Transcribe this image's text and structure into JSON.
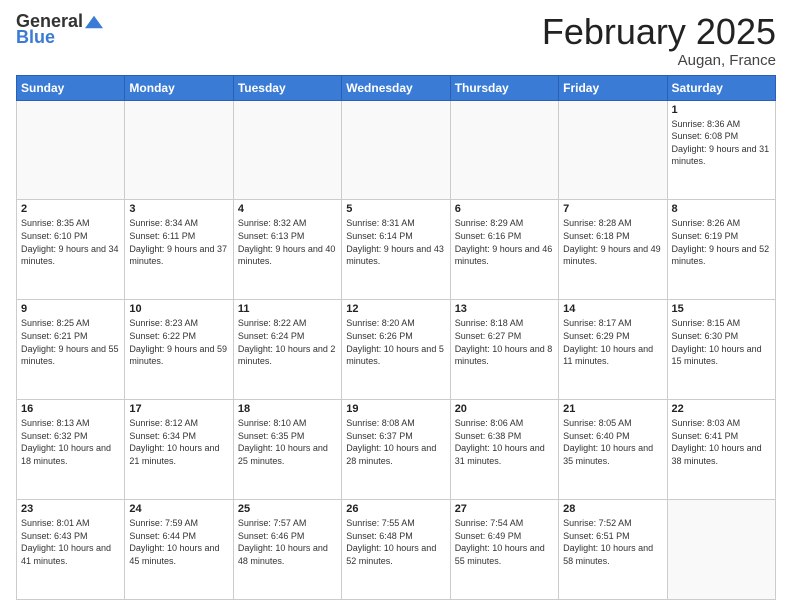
{
  "header": {
    "logo_general": "General",
    "logo_blue": "Blue",
    "month_year": "February 2025",
    "location": "Augan, France"
  },
  "days_of_week": [
    "Sunday",
    "Monday",
    "Tuesday",
    "Wednesday",
    "Thursday",
    "Friday",
    "Saturday"
  ],
  "weeks": [
    [
      {
        "day": "",
        "info": ""
      },
      {
        "day": "",
        "info": ""
      },
      {
        "day": "",
        "info": ""
      },
      {
        "day": "",
        "info": ""
      },
      {
        "day": "",
        "info": ""
      },
      {
        "day": "",
        "info": ""
      },
      {
        "day": "1",
        "info": "Sunrise: 8:36 AM\nSunset: 6:08 PM\nDaylight: 9 hours and 31 minutes."
      }
    ],
    [
      {
        "day": "2",
        "info": "Sunrise: 8:35 AM\nSunset: 6:10 PM\nDaylight: 9 hours and 34 minutes."
      },
      {
        "day": "3",
        "info": "Sunrise: 8:34 AM\nSunset: 6:11 PM\nDaylight: 9 hours and 37 minutes."
      },
      {
        "day": "4",
        "info": "Sunrise: 8:32 AM\nSunset: 6:13 PM\nDaylight: 9 hours and 40 minutes."
      },
      {
        "day": "5",
        "info": "Sunrise: 8:31 AM\nSunset: 6:14 PM\nDaylight: 9 hours and 43 minutes."
      },
      {
        "day": "6",
        "info": "Sunrise: 8:29 AM\nSunset: 6:16 PM\nDaylight: 9 hours and 46 minutes."
      },
      {
        "day": "7",
        "info": "Sunrise: 8:28 AM\nSunset: 6:18 PM\nDaylight: 9 hours and 49 minutes."
      },
      {
        "day": "8",
        "info": "Sunrise: 8:26 AM\nSunset: 6:19 PM\nDaylight: 9 hours and 52 minutes."
      }
    ],
    [
      {
        "day": "9",
        "info": "Sunrise: 8:25 AM\nSunset: 6:21 PM\nDaylight: 9 hours and 55 minutes."
      },
      {
        "day": "10",
        "info": "Sunrise: 8:23 AM\nSunset: 6:22 PM\nDaylight: 9 hours and 59 minutes."
      },
      {
        "day": "11",
        "info": "Sunrise: 8:22 AM\nSunset: 6:24 PM\nDaylight: 10 hours and 2 minutes."
      },
      {
        "day": "12",
        "info": "Sunrise: 8:20 AM\nSunset: 6:26 PM\nDaylight: 10 hours and 5 minutes."
      },
      {
        "day": "13",
        "info": "Sunrise: 8:18 AM\nSunset: 6:27 PM\nDaylight: 10 hours and 8 minutes."
      },
      {
        "day": "14",
        "info": "Sunrise: 8:17 AM\nSunset: 6:29 PM\nDaylight: 10 hours and 11 minutes."
      },
      {
        "day": "15",
        "info": "Sunrise: 8:15 AM\nSunset: 6:30 PM\nDaylight: 10 hours and 15 minutes."
      }
    ],
    [
      {
        "day": "16",
        "info": "Sunrise: 8:13 AM\nSunset: 6:32 PM\nDaylight: 10 hours and 18 minutes."
      },
      {
        "day": "17",
        "info": "Sunrise: 8:12 AM\nSunset: 6:34 PM\nDaylight: 10 hours and 21 minutes."
      },
      {
        "day": "18",
        "info": "Sunrise: 8:10 AM\nSunset: 6:35 PM\nDaylight: 10 hours and 25 minutes."
      },
      {
        "day": "19",
        "info": "Sunrise: 8:08 AM\nSunset: 6:37 PM\nDaylight: 10 hours and 28 minutes."
      },
      {
        "day": "20",
        "info": "Sunrise: 8:06 AM\nSunset: 6:38 PM\nDaylight: 10 hours and 31 minutes."
      },
      {
        "day": "21",
        "info": "Sunrise: 8:05 AM\nSunset: 6:40 PM\nDaylight: 10 hours and 35 minutes."
      },
      {
        "day": "22",
        "info": "Sunrise: 8:03 AM\nSunset: 6:41 PM\nDaylight: 10 hours and 38 minutes."
      }
    ],
    [
      {
        "day": "23",
        "info": "Sunrise: 8:01 AM\nSunset: 6:43 PM\nDaylight: 10 hours and 41 minutes."
      },
      {
        "day": "24",
        "info": "Sunrise: 7:59 AM\nSunset: 6:44 PM\nDaylight: 10 hours and 45 minutes."
      },
      {
        "day": "25",
        "info": "Sunrise: 7:57 AM\nSunset: 6:46 PM\nDaylight: 10 hours and 48 minutes."
      },
      {
        "day": "26",
        "info": "Sunrise: 7:55 AM\nSunset: 6:48 PM\nDaylight: 10 hours and 52 minutes."
      },
      {
        "day": "27",
        "info": "Sunrise: 7:54 AM\nSunset: 6:49 PM\nDaylight: 10 hours and 55 minutes."
      },
      {
        "day": "28",
        "info": "Sunrise: 7:52 AM\nSunset: 6:51 PM\nDaylight: 10 hours and 58 minutes."
      },
      {
        "day": "",
        "info": ""
      }
    ]
  ]
}
